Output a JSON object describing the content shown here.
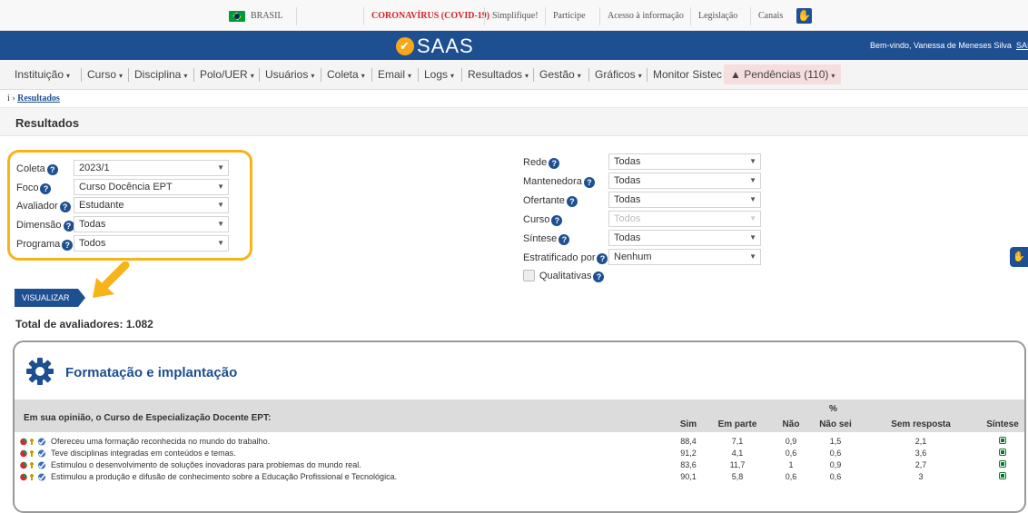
{
  "gov_bar": {
    "brasil": "BRASIL",
    "covid": "CORONAVÍRUS (COVID-19)",
    "links": [
      "Simplifique!",
      "Participe",
      "Acesso à informação",
      "Legislação",
      "Canais"
    ]
  },
  "header": {
    "logo": "SAAS",
    "welcome": "Bem-vindo, Vanessa de Meneses Silva",
    "welcome_link": "SAI"
  },
  "menu": {
    "items": [
      "Instituição",
      "Curso",
      "Disciplina",
      "Polo/UER",
      "Usuários",
      "Coleta",
      "Email",
      "Logs",
      "Resultados",
      "Gestão",
      "Gráficos"
    ],
    "monitor": "Monitor Sistec",
    "pendencias": "Pendências (110)"
  },
  "breadcrumb": {
    "prefix": "i ›",
    "current": "Resultados"
  },
  "page_title": "Resultados",
  "filters_left": [
    {
      "label": "Coleta",
      "value": "2023/1"
    },
    {
      "label": "Foco",
      "value": "Curso Docência EPT"
    },
    {
      "label": "Avaliador",
      "value": "Estudante"
    },
    {
      "label": "Dimensão",
      "value": "Todas"
    },
    {
      "label": "Programa",
      "value": "Todos"
    }
  ],
  "filters_right": [
    {
      "label": "Rede",
      "value": "Todas"
    },
    {
      "label": "Mantenedora",
      "value": "Todas"
    },
    {
      "label": "Ofertante",
      "value": "Todas"
    },
    {
      "label": "Curso",
      "value": "Todos"
    },
    {
      "label": "Síntese",
      "value": "Todas"
    },
    {
      "label": "Estratificado por",
      "value": "Nenhum"
    }
  ],
  "qualitativas": "Qualitativas",
  "visualizar": "VISUALIZAR",
  "total": "Total de avaliadores: 1.082",
  "section": {
    "title": "Formatação e implantação",
    "question": "Em sua opinião, o Curso de Especialização Docente EPT:",
    "pct": "%",
    "columns": [
      "Sim",
      "Em parte",
      "Não",
      "Não sei",
      "Sem resposta",
      "Síntese"
    ],
    "rows": [
      {
        "text": "Ofereceu uma formação reconhecida no mundo do trabalho.",
        "sim": "88,4",
        "em_parte": "7,1",
        "nao": "0,9",
        "nao_sei": "1,5",
        "sem_resposta": "2,1"
      },
      {
        "text": "Teve disciplinas integradas em conteúdos e temas.",
        "sim": "91,2",
        "em_parte": "4,1",
        "nao": "0,6",
        "nao_sei": "0,6",
        "sem_resposta": "3,6"
      },
      {
        "text": "Estimulou o desenvolvimento de soluções inovadoras para problemas do mundo real.",
        "sim": "83,6",
        "em_parte": "11,7",
        "nao": "1",
        "nao_sei": "0,9",
        "sem_resposta": "2,7"
      },
      {
        "text": "Estimulou a produção e difusão de conhecimento sobre a Educação Profissional e Tecnológica.",
        "sim": "90,1",
        "em_parte": "5,8",
        "nao": "0,6",
        "nao_sei": "0,6",
        "sem_resposta": "3"
      }
    ]
  },
  "colors": {
    "brand": "#1d4f91",
    "highlight": "#f5b41a",
    "covid": "#d4232b"
  }
}
